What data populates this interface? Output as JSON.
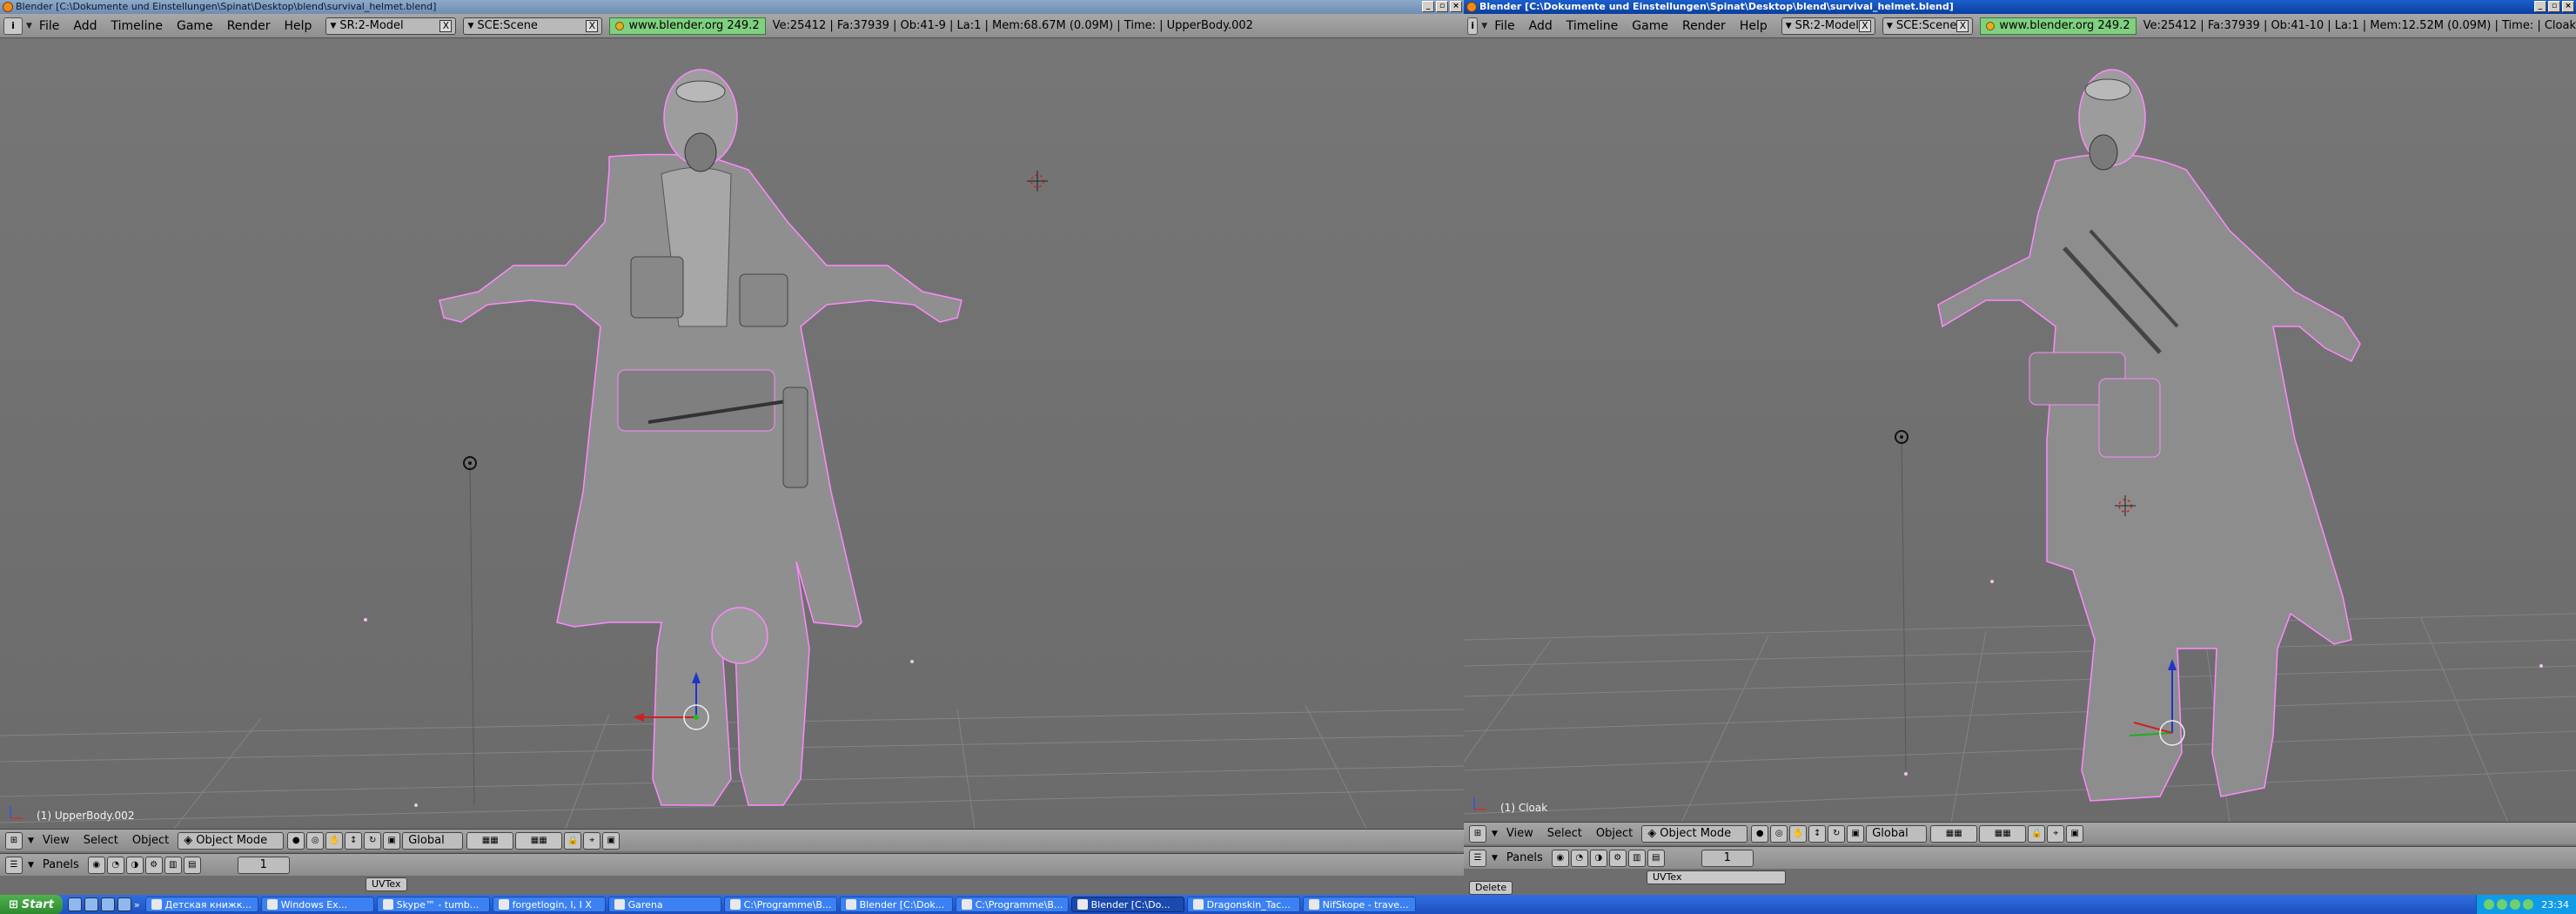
{
  "left_window": {
    "title": "Blender [C:\\Dokumente und Einstellungen\\Spinat\\Desktop\\blend\\survival_helmet.blend]",
    "menus": [
      "File",
      "Add",
      "Timeline",
      "Game",
      "Render",
      "Help"
    ],
    "screen_field": "SR:2-Model",
    "scene_field": "SCE:Scene",
    "url": "www.blender.org 249.2",
    "stats": "Ve:25412 | Fa:37939 | Ob:41-9 | La:1  | Mem:68.67M (0.09M)  | Time: | UpperBody.002",
    "viewport_label": "(1) UpperBody.002",
    "header": {
      "view": "View",
      "select": "Select",
      "object": "Object",
      "mode": "Object Mode",
      "orientation": "Global"
    },
    "panels_label": "Panels",
    "frame": "1",
    "lower_tab": "UVTex"
  },
  "right_window": {
    "title": "Blender [C:\\Dokumente und Einstellungen\\Spinat\\Desktop\\blend\\survival_helmet.blend]",
    "menus": [
      "File",
      "Add",
      "Timeline",
      "Game",
      "Render",
      "Help"
    ],
    "screen_field": "SR:2-Model",
    "scene_field": "SCE:Scene",
    "url": "www.blender.org 249.2",
    "stats": "Ve:25412 | Fa:37939 | Ob:41-10 | La:1  | Mem:12.52M (0.09M)  | Time: | Cloak",
    "viewport_label": "(1) Cloak",
    "header": {
      "view": "View",
      "select": "Select",
      "object": "Object",
      "mode": "Object Mode",
      "orientation": "Global"
    },
    "panels_label": "Panels",
    "frame": "1",
    "lower_tab": "UVTex",
    "delete_label": "Delete"
  },
  "taskbar": {
    "start": "Start",
    "tasks": [
      {
        "label": "Детская книжк...",
        "active": false
      },
      {
        "label": "Windows Ex...",
        "active": false
      },
      {
        "label": "Skype™ - tumb...",
        "active": false
      },
      {
        "label": "forgetlogin, I, I X",
        "active": false
      },
      {
        "label": "Garena",
        "active": false
      },
      {
        "label": "C:\\Programme\\B...",
        "active": false
      },
      {
        "label": "Blender [C:\\Dok...",
        "active": false
      },
      {
        "label": "C:\\Programme\\B...",
        "active": false
      },
      {
        "label": "Blender [C:\\Do...",
        "active": true
      },
      {
        "label": "Dragonskin_Tac...",
        "active": false
      },
      {
        "label": "NifSkope - trave...",
        "active": false
      }
    ],
    "clock": "23:34"
  },
  "colors": {
    "viewport": "#737373",
    "selection_outline": "#ff88ff",
    "active_title": "#0a3e9e"
  }
}
